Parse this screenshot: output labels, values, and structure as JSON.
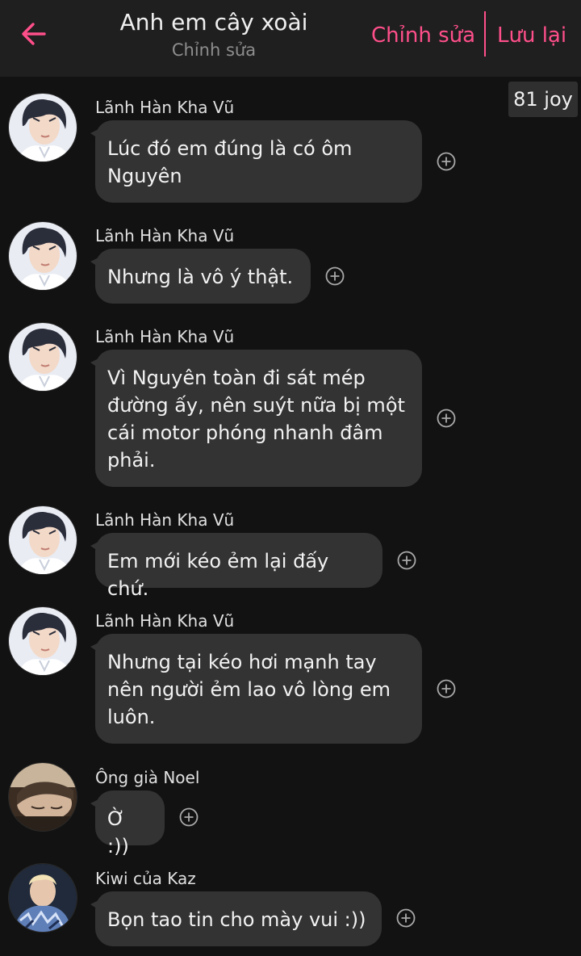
{
  "header": {
    "title": "Anh em cây xoài",
    "subtitle": "Chỉnh sửa",
    "edit_label": "Chỉnh sửa",
    "save_label": "Lưu lại"
  },
  "joy_badge": "81 joy",
  "colors": {
    "accent": "#ff4f8b",
    "bubble": "#333333",
    "background": "#121212",
    "header": "#1f1f1f"
  },
  "messages": [
    {
      "sender": "Lãnh Hàn Kha Vũ",
      "text": "Lúc đó em đúng là có ôm Nguyên",
      "avatar": "avatar-boy"
    },
    {
      "sender": "Lãnh Hàn Kha Vũ",
      "text": "Nhưng là vô ý thật.",
      "avatar": "avatar-boy"
    },
    {
      "sender": "Lãnh Hàn Kha Vũ",
      "text": "Vì Nguyên toàn đi sát mép đường ấy, nên suýt nữa bị một cái motor phóng nhanh đâm phải.",
      "avatar": "avatar-boy"
    },
    {
      "sender": "Lãnh Hàn Kha Vũ",
      "text": "Em mới kéo ẻm lại đấy chứ.",
      "avatar": "avatar-boy"
    },
    {
      "sender": "Lãnh Hàn Kha Vũ",
      "text": "Nhưng tại kéo hơi mạnh tay nên người ẻm lao vô lòng em luôn.",
      "avatar": "avatar-boy"
    },
    {
      "sender": "Ông già Noel",
      "text": "Ờ :))",
      "avatar": "avatar-sleeping"
    },
    {
      "sender": "Kiwi của Kaz",
      "text": "Bọn tao tin cho mày vui :))",
      "avatar": "avatar-blond"
    }
  ]
}
